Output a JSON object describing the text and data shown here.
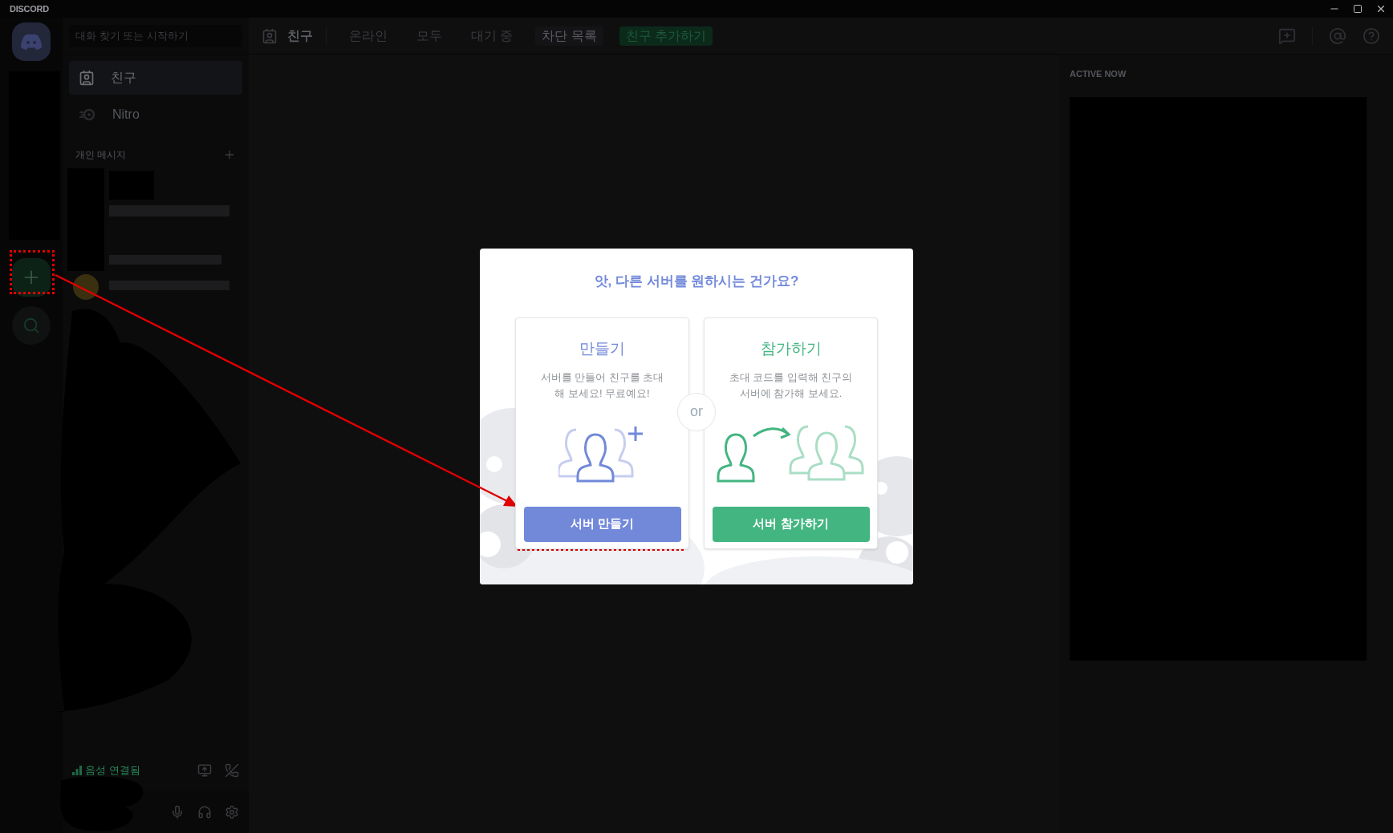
{
  "app_title": "DISCORD",
  "search": {
    "placeholder": "대화 찾기 또는 시작하기"
  },
  "header": {
    "title": "친구"
  },
  "tabs": [
    {
      "label": "온라인",
      "kind": "tab",
      "selected": false
    },
    {
      "label": "모두",
      "kind": "tab",
      "selected": false
    },
    {
      "label": "대기 중",
      "kind": "tab",
      "selected": false
    },
    {
      "label": "차단 목록",
      "kind": "tab",
      "selected": true
    },
    {
      "label": "친구 추가하기",
      "kind": "action"
    }
  ],
  "sidebar": {
    "items": [
      {
        "label": "친구",
        "kind": "friends",
        "selected": true
      },
      {
        "label": "Nitro",
        "kind": "nitro",
        "selected": false
      }
    ],
    "dm_header": "개인 메시지"
  },
  "voice": {
    "status": "음성 연결됨"
  },
  "active_now": {
    "title": "ACTIVE NOW"
  },
  "modal": {
    "title": "앗, 다른 서버를 원하시는 건가요?",
    "divider": "or",
    "cards": [
      {
        "kind": "create",
        "title": "만들기",
        "description": "서버를 만들어 친구를 초대해 보세요! 무료예요!",
        "button": "서버 만들기",
        "color": "#7289da"
      },
      {
        "kind": "join",
        "title": "참가하기",
        "description": "초대 코드를 입력해 친구의 서버에 참가해 보세요.",
        "button": "서버 참가하기",
        "color": "#43b581"
      }
    ]
  }
}
